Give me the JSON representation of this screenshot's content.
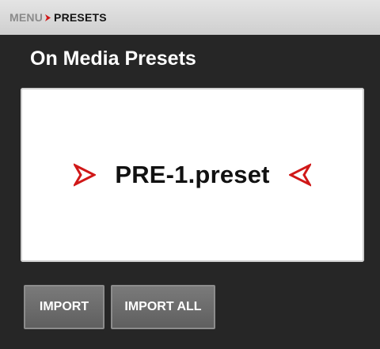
{
  "breadcrumb": {
    "parent": "MENU",
    "current": "PRESETS",
    "separator_icon": "chevron-right-icon",
    "accent_color": "#d01818"
  },
  "page": {
    "title": "On Media Presets"
  },
  "preset_selector": {
    "selected": "PRE-1.preset",
    "prev_icon": "selector-arrow-left-icon",
    "next_icon": "selector-arrow-right-icon",
    "arrow_color": "#d01818"
  },
  "actions": {
    "import_label": "IMPORT",
    "import_all_label": "IMPORT ALL"
  }
}
